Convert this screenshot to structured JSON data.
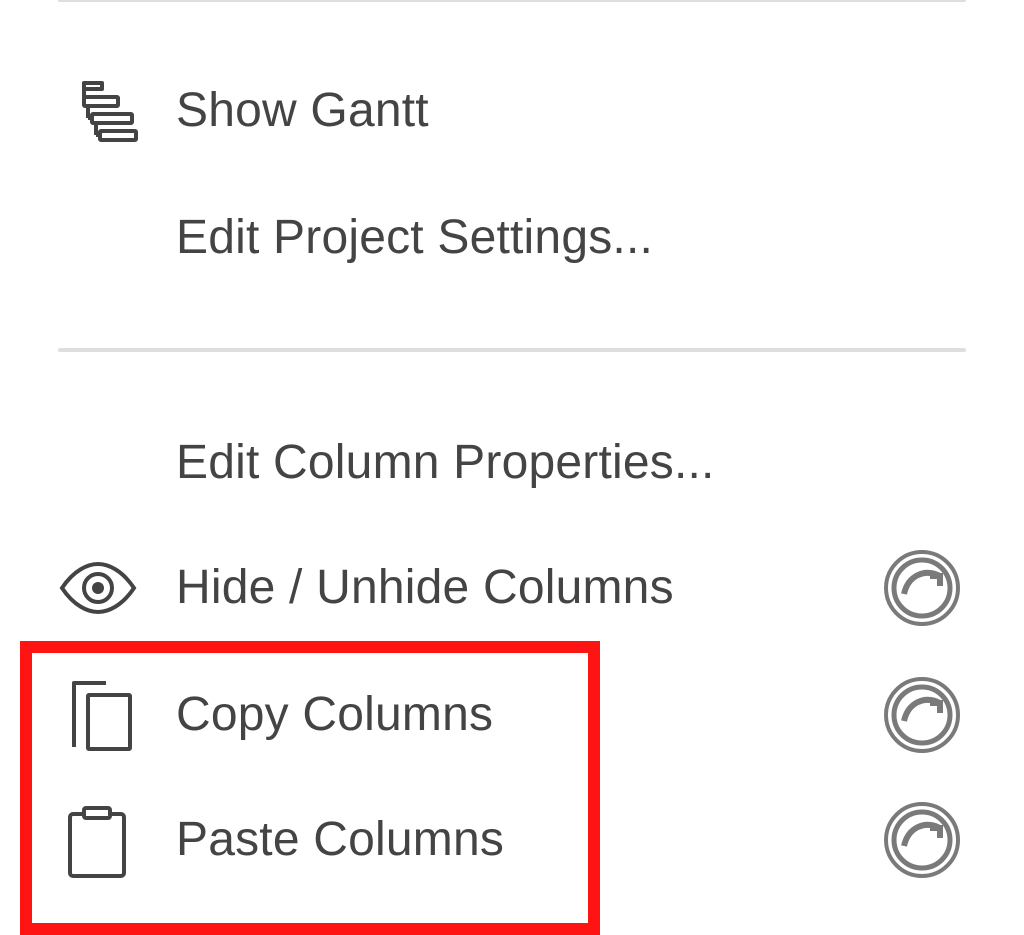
{
  "menu": {
    "items": [
      {
        "label": "Show Gantt",
        "icon": "gantt-icon",
        "premium": false
      },
      {
        "label": "Edit Project Settings...",
        "icon": null,
        "premium": false
      },
      {
        "label": "Edit Column Properties...",
        "icon": null,
        "premium": false
      },
      {
        "label": "Hide / Unhide Columns",
        "icon": "eye-icon",
        "premium": true
      },
      {
        "label": "Copy Columns",
        "icon": "copy-icon",
        "premium": true
      },
      {
        "label": "Paste Columns",
        "icon": "clipboard-icon",
        "premium": true
      }
    ]
  },
  "premium_icon": "premium-feature-icon",
  "colors": {
    "text": "#444444",
    "divider": "#dedede",
    "highlight": "#ff1414",
    "premium": "#7a7a7a"
  }
}
